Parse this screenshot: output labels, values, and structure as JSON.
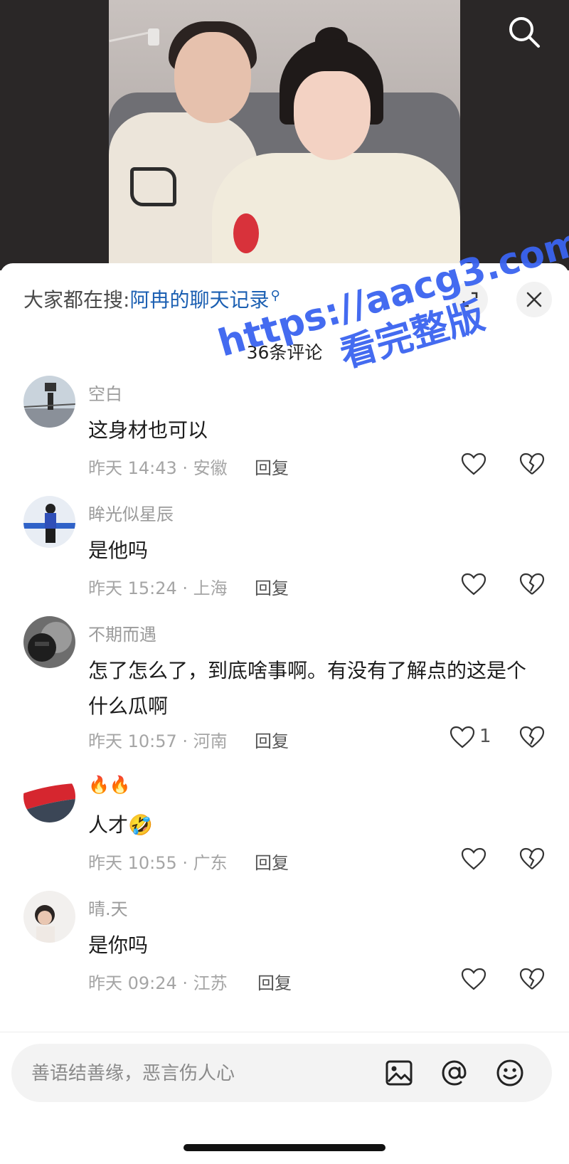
{
  "video": {
    "search_icon": "search-icon"
  },
  "hot_search": {
    "prefix": "大家都在搜:",
    "keyword": "阿冉的聊天记录",
    "icon": "magnifier-icon"
  },
  "header": {
    "expand_icon": "expand-icon",
    "close_icon": "close-icon",
    "comment_count": "36条评论"
  },
  "watermark": {
    "line1": "https://aacg3.com",
    "line2": "看完整版"
  },
  "comments": [
    {
      "nickname": "空白",
      "text": "这身材也可以",
      "time": "昨天 14:43 · 安徽",
      "reply": "回复",
      "likes": ""
    },
    {
      "nickname": "眸光似星辰",
      "text": "是他吗",
      "time": "昨天 15:24 · 上海",
      "reply": "回复",
      "likes": ""
    },
    {
      "nickname": "不期而遇",
      "text": "怎了怎么了，到底啥事啊。有没有了解点的这是个什么瓜啊",
      "time": "昨天 10:57 · 河南",
      "reply": "回复",
      "likes": "1"
    },
    {
      "nickname": "🔥🔥",
      "text": "人才🤣",
      "time": "昨天 10:55 · 广东",
      "reply": "回复",
      "likes": ""
    },
    {
      "nickname": "晴.天",
      "text": "是你吗",
      "time": "昨天 09:24 · 江苏",
      "reply": "回复",
      "likes": ""
    }
  ],
  "input": {
    "placeholder": "善语结善缘，恶言伤人心",
    "value": "",
    "icons": [
      "image-icon",
      "at-icon",
      "emoji-icon"
    ]
  },
  "colors": {
    "link": "#1b5fb2",
    "watermark": "#3a64f0",
    "sheet_bg": "#ffffff",
    "video_bg": "#2a2727"
  }
}
